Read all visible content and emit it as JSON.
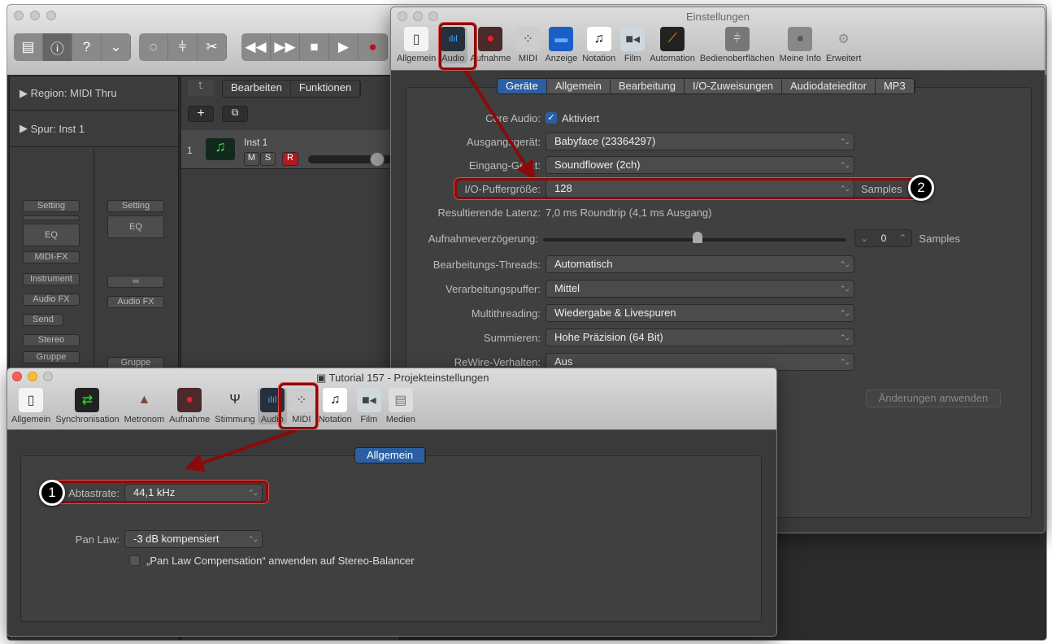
{
  "logic": {
    "toolbar_icons": [
      "library-icon",
      "info-icon",
      "help-icon",
      "editor-icon",
      "tuner-icon",
      "mixer-icon",
      "scissors-icon"
    ],
    "transport_icons": [
      "rewind-icon",
      "fast-forward-icon",
      "stop-icon",
      "play-icon",
      "record-icon"
    ],
    "inspector": {
      "region_label": "Region:",
      "region_value": "MIDI Thru",
      "track_label": "Spur:",
      "track_value": "Inst 1"
    },
    "strip_left": {
      "setting": "Setting",
      "eq": "EQ",
      "midi_fx": "MIDI-FX",
      "instrument": "Instrument",
      "audio_fx": "Audio FX",
      "send": "Send",
      "stereo": "Stereo",
      "group": "Gruppe"
    },
    "strip_right": {
      "setting": "Setting",
      "eq": "EQ",
      "link": "∞",
      "audio_fx": "Audio FX",
      "group": "Gruppe"
    },
    "tracks_menu": {
      "edit": "Bearbeiten",
      "functions": "Funktionen"
    },
    "track": {
      "number": "1",
      "name": "Inst 1",
      "mute": "M",
      "solo": "S",
      "record": "R",
      "volume": 0.85
    }
  },
  "prefs": {
    "title": "Einstellungen",
    "toolbar": [
      {
        "label": "Allgemein",
        "icon": "switch-icon"
      },
      {
        "label": "Audio",
        "icon": "waveform-icon"
      },
      {
        "label": "Aufnahme",
        "icon": "record-icon"
      },
      {
        "label": "MIDI",
        "icon": "midi-icon"
      },
      {
        "label": "Anzeige",
        "icon": "display-icon"
      },
      {
        "label": "Notation",
        "icon": "notation-icon"
      },
      {
        "label": "Film",
        "icon": "film-icon"
      },
      {
        "label": "Automation",
        "icon": "automation-icon"
      },
      {
        "label": "Bedienoberflächen",
        "icon": "control-surface-icon"
      },
      {
        "label": "Meine Info",
        "icon": "user-icon"
      },
      {
        "label": "Erweitert",
        "icon": "gear-icon"
      }
    ],
    "tabs": [
      "Geräte",
      "Allgemein",
      "Bearbeitung",
      "I/O-Zuweisungen",
      "Audiodateieditor",
      "MP3"
    ],
    "core_audio_label": "Core Audio:",
    "core_audio_value": "Aktiviert",
    "output_label": "Ausgangsgerät:",
    "output_value": "Babyface (23364297)",
    "input_label": "Eingang-Gerät:",
    "input_value": "Soundflower (2ch)",
    "buffer_label": "I/O-Puffergröße:",
    "buffer_value": "128",
    "buffer_unit": "Samples",
    "latency_label": "Resultierende Latenz:",
    "latency_value": "7,0 ms Roundtrip (4,1 ms Ausgang)",
    "delay_label": "Aufnahmeverzögerung:",
    "delay_value": "0",
    "delay_unit": "Samples",
    "delay_slider": 0.5,
    "threads_label": "Bearbeitungs-Threads:",
    "threads_value": "Automatisch",
    "procbuf_label": "Verarbeitungspuffer:",
    "procbuf_value": "Mittel",
    "multi_label": "Multithreading:",
    "multi_value": "Wiedergabe & Livespuren",
    "sum_label": "Summieren:",
    "sum_value": "Hohe Präzision (64 Bit)",
    "rewire_label": "ReWire-Verhalten:",
    "rewire_value": "Aus",
    "apply": "Änderungen anwenden"
  },
  "project": {
    "title": "Tutorial 157 - Projekteinstellungen",
    "toolbar": [
      {
        "label": "Allgemein",
        "icon": "switch-icon"
      },
      {
        "label": "Synchronisation",
        "icon": "sync-icon"
      },
      {
        "label": "Metronom",
        "icon": "metronome-icon"
      },
      {
        "label": "Aufnahme",
        "icon": "record-icon"
      },
      {
        "label": "Stimmung",
        "icon": "tuning-fork-icon"
      },
      {
        "label": "Audio",
        "icon": "waveform-icon"
      },
      {
        "label": "MIDI",
        "icon": "midi-icon"
      },
      {
        "label": "Notation",
        "icon": "notation-icon"
      },
      {
        "label": "Film",
        "icon": "film-icon"
      },
      {
        "label": "Medien",
        "icon": "media-icon"
      }
    ],
    "tab": "Allgemein",
    "rate_label": "Abtastrate:",
    "rate_value": "44,1 kHz",
    "pan_label": "Pan Law:",
    "pan_value": "-3 dB kompensiert",
    "pan_check": "„Pan Law Compensation“ anwenden auf Stereo-Balancer"
  },
  "annotations": {
    "badge1": "1",
    "badge2": "2"
  }
}
